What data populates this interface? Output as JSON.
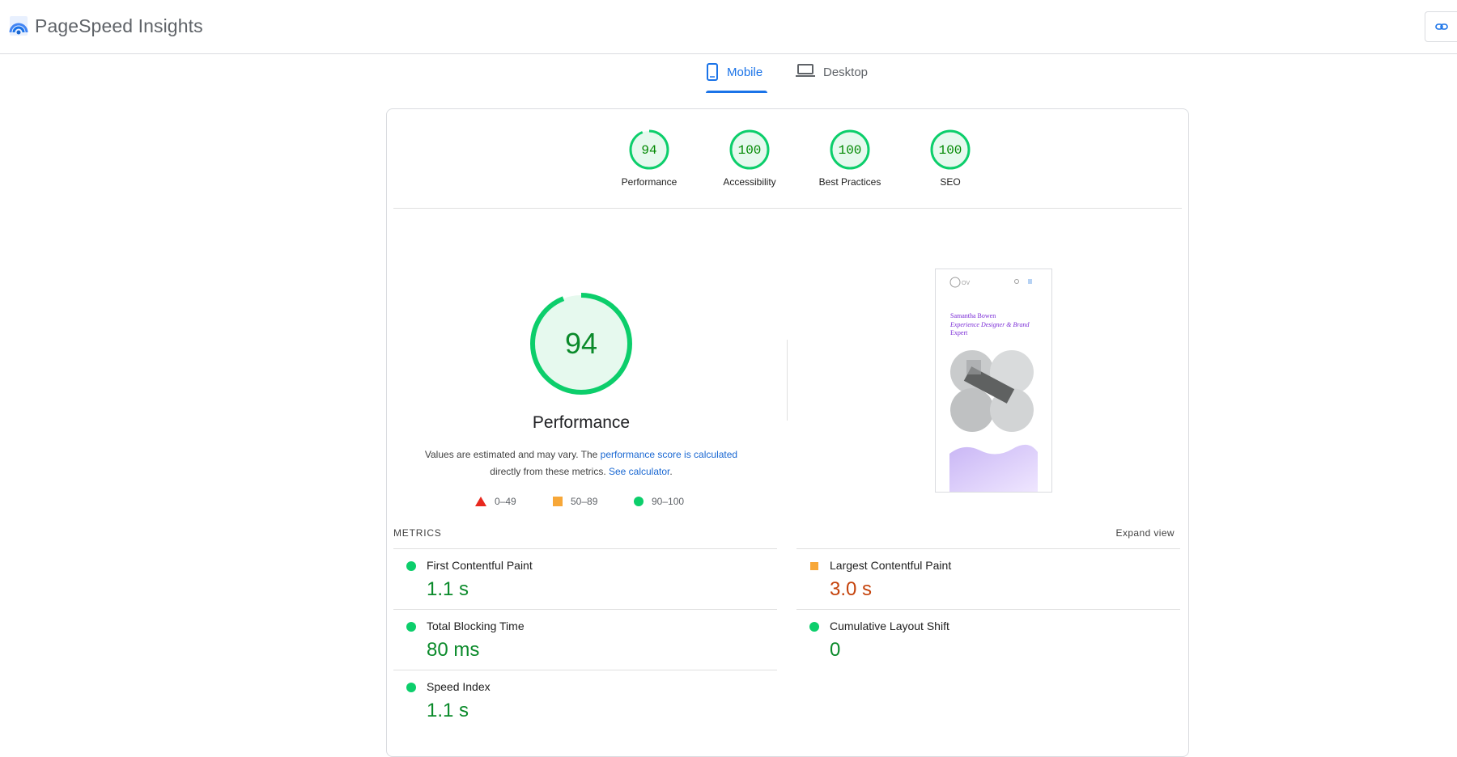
{
  "app": {
    "name": "PageSpeed Insights"
  },
  "tabs": [
    {
      "label": "Mobile",
      "icon": "smartphone-icon",
      "selected": true
    },
    {
      "label": "Desktop",
      "icon": "laptop-icon",
      "selected": false
    }
  ],
  "scores": [
    {
      "label": "Performance",
      "value": "94",
      "score": 94
    },
    {
      "label": "Accessibility",
      "value": "100",
      "score": 100
    },
    {
      "label": "Best Practices",
      "value": "100",
      "score": 100
    },
    {
      "label": "SEO",
      "value": "100",
      "score": 100
    }
  ],
  "main_score": {
    "value": "94",
    "score": 94,
    "title": "Performance",
    "desc_prefix": "Values are estimated and may vary. The ",
    "desc_link1": "performance score is calculated",
    "desc_mid": " directly from these metrics. ",
    "desc_link2": "See calculator",
    "desc_suffix": "."
  },
  "legend": [
    {
      "range": "0–49",
      "shape": "triangle",
      "color": "#e8281e"
    },
    {
      "range": "50–89",
      "shape": "square",
      "color": "#f7a738"
    },
    {
      "range": "90–100",
      "shape": "circle",
      "color": "#0cce6b"
    }
  ],
  "screenshot": {
    "name_line": "Samantha Bowen",
    "tagline_line1": "Experience Designer & Brand",
    "tagline_line2": "Expert",
    "logo_text": "OV"
  },
  "metrics": {
    "heading": "METRICS",
    "expand_label": "Expand view",
    "items": [
      {
        "name": "First Contentful Paint",
        "value": "1.1 s",
        "status": "good"
      },
      {
        "name": "Largest Contentful Paint",
        "value": "3.0 s",
        "status": "average"
      },
      {
        "name": "Total Blocking Time",
        "value": "80 ms",
        "status": "good"
      },
      {
        "name": "Cumulative Layout Shift",
        "value": "0",
        "status": "good"
      },
      {
        "name": "Speed Index",
        "value": "1.1 s",
        "status": "good"
      }
    ]
  },
  "colors": {
    "accent": "#1a73e8",
    "good": "#0cce6b",
    "average": "#ffa400",
    "poor": "#ff4e42"
  }
}
